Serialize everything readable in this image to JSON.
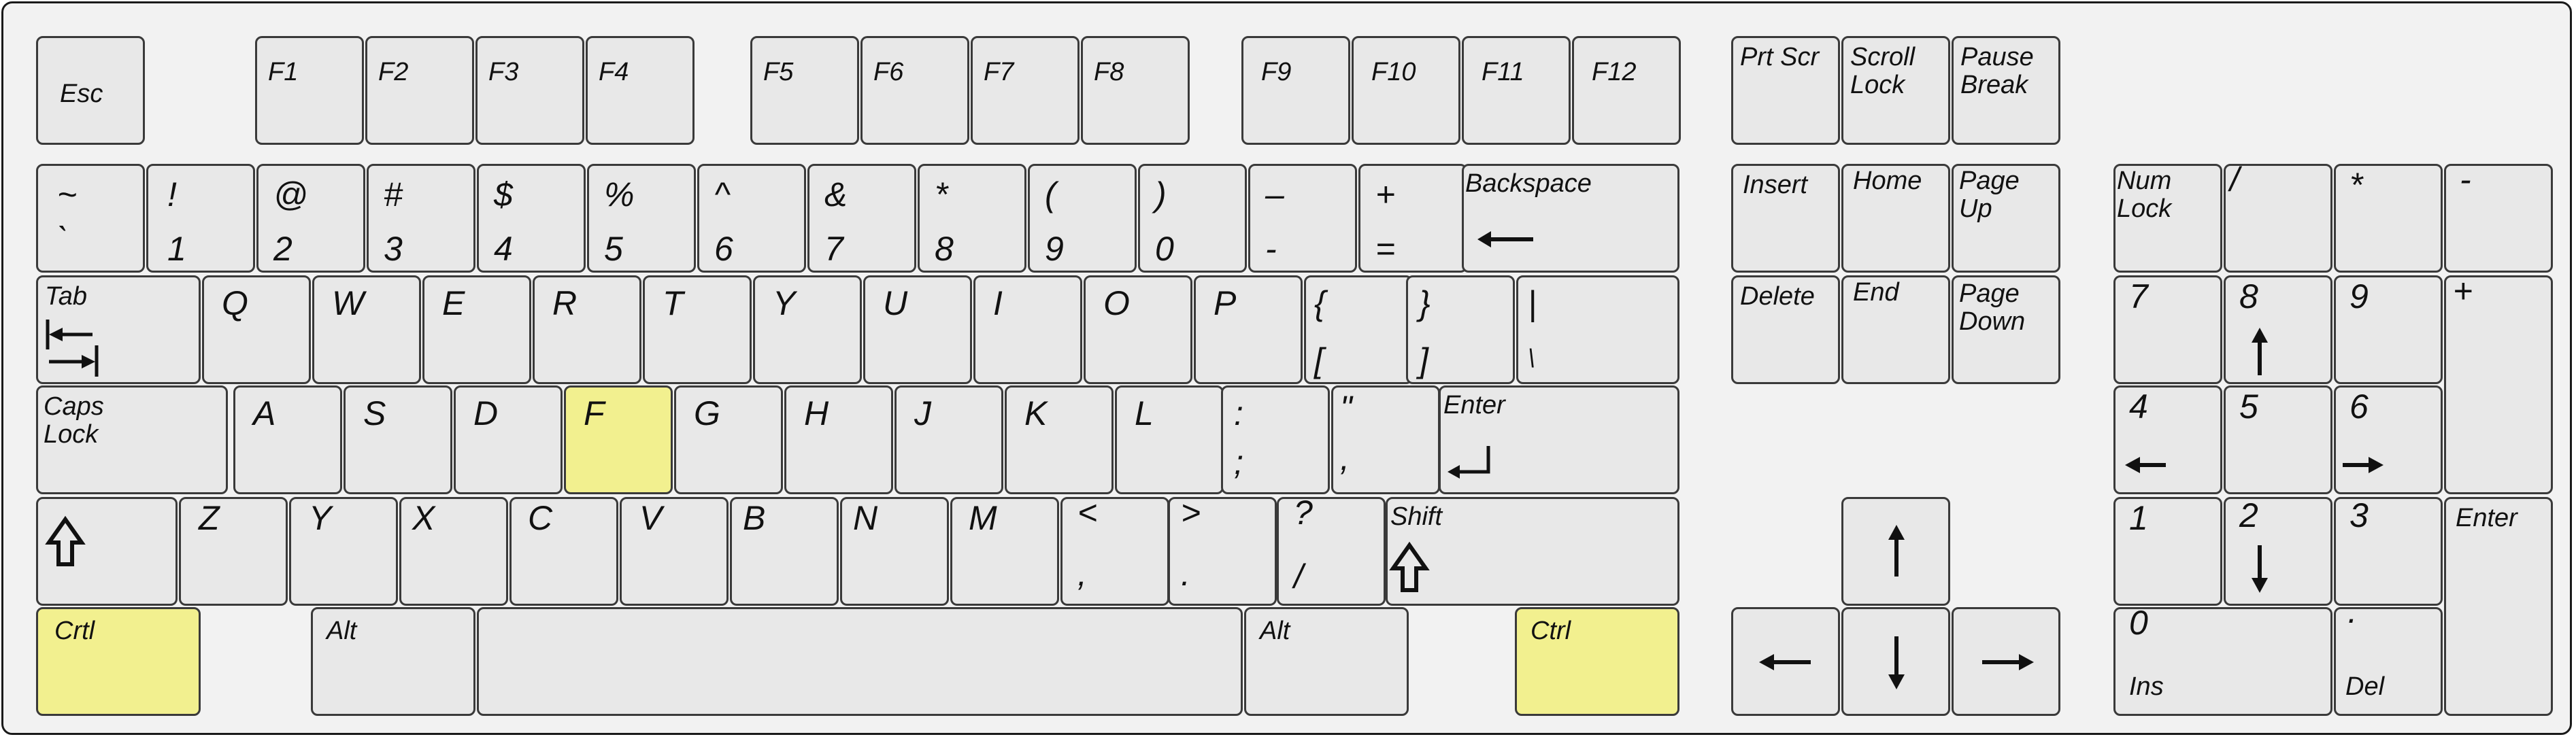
{
  "highlight_color": "#f2f08f",
  "key_color": "#e8e8e8",
  "keys": {
    "esc": "Esc",
    "f1": "F1",
    "f2": "F2",
    "f3": "F3",
    "f4": "F4",
    "f5": "F5",
    "f6": "F6",
    "f7": "F7",
    "f8": "F8",
    "f9": "F9",
    "f10": "F10",
    "f11": "F11",
    "f12": "F12",
    "prtscr": "Prt Scr",
    "scrolllock": "Scroll\nLock",
    "pausebreak": "Pause\nBreak",
    "tilde_top": "~",
    "tilde_bot": "`",
    "k1_top": "!",
    "k1_bot": "1",
    "k2_top": "@",
    "k2_bot": "2",
    "k3_top": "#",
    "k3_bot": "3",
    "k4_top": "$",
    "k4_bot": "4",
    "k5_top": "%",
    "k5_bot": "5",
    "k6_top": "^",
    "k6_bot": "6",
    "k7_top": "&",
    "k7_bot": "7",
    "k8_top": "*",
    "k8_bot": "8",
    "k9_top": "(",
    "k9_bot": "9",
    "k0_top": ")",
    "k0_bot": "0",
    "minus_top": "–",
    "minus_bot": "-",
    "equals_top": "+",
    "equals_bot": "=",
    "backspace": "Backspace",
    "tab": "Tab",
    "q": "Q",
    "w": "W",
    "e": "E",
    "r": "R",
    "t": "T",
    "y": "Y",
    "u": "U",
    "i": "I",
    "o": "O",
    "p": "P",
    "lbrace_top": "{",
    "lbrace_bot": "[",
    "rbrace_top": "}",
    "rbrace_bot": "]",
    "pipe_top": "|",
    "pipe_bot": "\\",
    "capslock": "Caps\nLock",
    "a": "A",
    "s": "S",
    "d": "D",
    "f": "F",
    "g": "G",
    "h": "H",
    "j": "J",
    "k": "K",
    "l": "L",
    "colon_top": ":",
    "colon_bot": ";",
    "quote_top": "\"",
    "quote_bot": ",",
    "enter": "Enter",
    "z": "Z",
    "x": "X",
    "c": "C",
    "v": "V",
    "b": "B",
    "n": "N",
    "m": "M",
    "comma_top": "<",
    "comma_bot": ",",
    "period_top": ">",
    "period_bot": ".",
    "slash_top": "?",
    "slash_bot": "/",
    "shift_right": "Shift",
    "ctrl_left": "Crtl",
    "alt_left": "Alt",
    "alt_right": "Alt",
    "ctrl_right": "Ctrl",
    "insert": "Insert",
    "home": "Home",
    "pageup": "Page\nUp",
    "delete": "Delete",
    "end": "End",
    "pagedown": "Page\nDown",
    "numlock": "Num\nLock",
    "np_slash": "/",
    "np_star": "*",
    "np_minus": "-",
    "np_plus": "+",
    "np7": "7",
    "np8": "8",
    "np9": "9",
    "np4": "4",
    "np5": "5",
    "np6": "6",
    "np1": "1",
    "np2": "2",
    "np3": "3",
    "np_enter": "Enter",
    "np0_top": "0",
    "np0_bot": "Ins",
    "npdot_top": "·",
    "npdot_bot": "Del"
  }
}
